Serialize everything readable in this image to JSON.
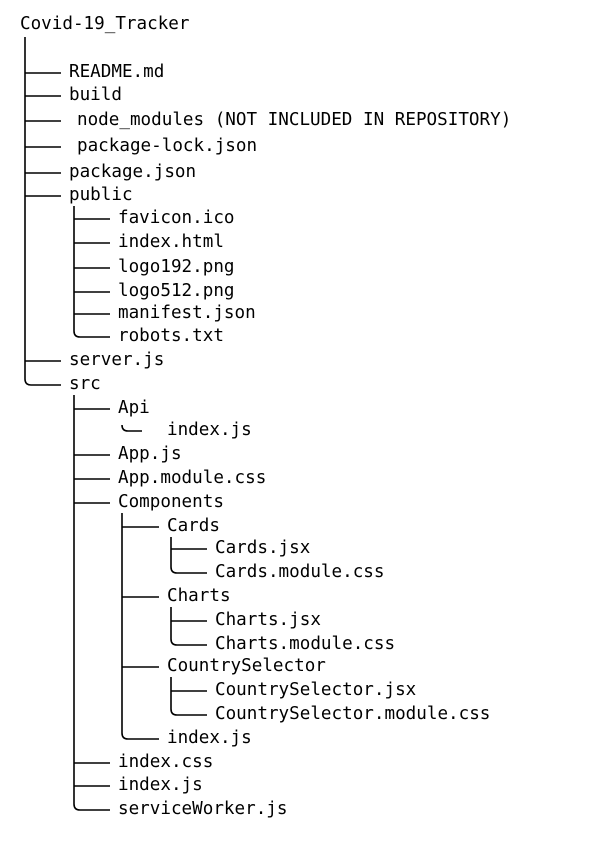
{
  "title": "Covid-19_Tracker",
  "nodes": [
    {
      "name": "README.md",
      "depth": 1
    },
    {
      "name": "build",
      "depth": 1
    },
    {
      "name": "node_modules (NOT INCLUDED IN REPOSITORY)",
      "depth": 1
    },
    {
      "name": "package-lock.json",
      "depth": 1
    },
    {
      "name": "package.json",
      "depth": 1
    },
    {
      "name": "public",
      "depth": 1
    },
    {
      "name": "favicon.ico",
      "depth": 2
    },
    {
      "name": "index.html",
      "depth": 2
    },
    {
      "name": "logo192.png",
      "depth": 2
    },
    {
      "name": "logo512.png",
      "depth": 2
    },
    {
      "name": "manifest.json",
      "depth": 2
    },
    {
      "name": "robots.txt",
      "depth": 2
    },
    {
      "name": "server.js",
      "depth": 1
    },
    {
      "name": "src",
      "depth": 1
    },
    {
      "name": "Api",
      "depth": 2
    },
    {
      "name": "index.js",
      "depth": 3
    },
    {
      "name": "App.js",
      "depth": 2
    },
    {
      "name": "App.module.css",
      "depth": 2
    },
    {
      "name": "Components",
      "depth": 2
    },
    {
      "name": "Cards",
      "depth": 3
    },
    {
      "name": "Cards.jsx",
      "depth": 4
    },
    {
      "name": "Cards.module.css",
      "depth": 4
    },
    {
      "name": "Charts",
      "depth": 3
    },
    {
      "name": "Charts.jsx",
      "depth": 4
    },
    {
      "name": "Charts.module.css",
      "depth": 4
    },
    {
      "name": "CountrySelector",
      "depth": 3
    },
    {
      "name": "CountrySelector.jsx",
      "depth": 4
    },
    {
      "name": "CountrySelector.module.css",
      "depth": 4
    },
    {
      "name": "index.js",
      "depth": 3
    },
    {
      "name": "index.css",
      "depth": 2
    },
    {
      "name": "index.js",
      "depth": 2
    },
    {
      "name": "serviceWorker.js",
      "depth": 2
    }
  ]
}
